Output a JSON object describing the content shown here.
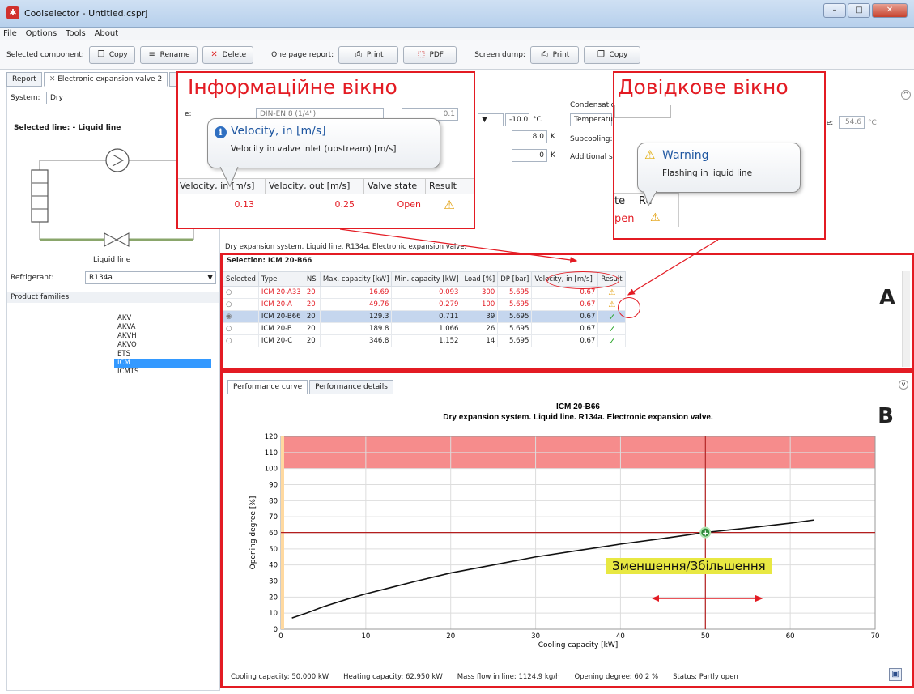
{
  "window": {
    "title": "Coolselector - Untitled.csprj",
    "minimize": "–",
    "maximize": "□",
    "close": "✕"
  },
  "menu": [
    "File",
    "Options",
    "Tools",
    "About"
  ],
  "toolbar": {
    "selected_component_label": "Selected component:",
    "copy": "Copy",
    "rename": "Rename",
    "delete": "Delete",
    "one_page_report_label": "One page report:",
    "print": "Print",
    "pdf": "PDF",
    "screen_dump_label": "Screen dump:",
    "print2": "Print",
    "copy2": "Copy"
  },
  "tabs": {
    "report": "Report",
    "component": "Electronic expansion valve 2",
    "add": "+"
  },
  "left": {
    "system_label": "System:",
    "system_value": "Dry",
    "selected_line": "Selected line: - Liquid line",
    "diagram_caption": "Liquid line",
    "refrigerant_label": "Refrigerant:",
    "refrigerant_value": "R134a",
    "product_families_label": "Product families",
    "families": [
      "AKV",
      "AKVA",
      "AKVH",
      "AKVO",
      "ETS",
      "ICM",
      "ICMTS"
    ],
    "selected_family": "ICM"
  },
  "params": {
    "connection_value": "DIN-EN 8 (1/4\")",
    "connection_extra": "0.1",
    "connection_label_tail": "e:",
    "evap_temp": "-10.0",
    "evap_temp_unit": "°C",
    "superheat": "8.0",
    "superheat_unit": "K",
    "extra": "0",
    "extra_unit": "K",
    "condensation_label": "Condensation",
    "temperature_mode": "Temperature",
    "subcooling_label": "Subcooling:",
    "additional_label": "Additional su",
    "ture_label": "ture:",
    "ture_value": "54.6",
    "ture_unit": "°C"
  },
  "info_panel": {
    "heading": "Інформаційне вікно",
    "tooltip_title": "Velocity, in [m/s]",
    "tooltip_text": "Velocity in valve inlet (upstream) [m/s]",
    "cols": [
      "Velocity, in [m/s]",
      "Velocity, out [m/s]",
      "Valve state",
      "Result"
    ],
    "row": [
      "0.13",
      "0.25",
      "Open"
    ]
  },
  "help_panel": {
    "heading": "Довідкове вікно",
    "tooltip_title": "Warning",
    "tooltip_text": "Flashing in liquid line",
    "col_fragment": "te",
    "col_fragment2": "Re",
    "cell_fragment": "pen"
  },
  "description": "Dry expansion system. Liquid line. R134a. Electronic expansion valve.",
  "selection": {
    "title": "Selection: ICM 20-B66",
    "columns": [
      "Selected",
      "Type",
      "NS",
      "Max. capacity [kW]",
      "Min. capacity [kW]",
      "Load [%]",
      "DP [bar]",
      "Velocity, in [m/s]",
      "Result"
    ],
    "rows": [
      {
        "type": "ICM 20-A33",
        "ns": "20",
        "max": "16.69",
        "min": "0.093",
        "load": "300",
        "dp": "5.695",
        "vel": "0.67",
        "result": "warn",
        "red": true,
        "selected": false
      },
      {
        "type": "ICM 20-A",
        "ns": "20",
        "max": "49.76",
        "min": "0.279",
        "load": "100",
        "dp": "5.695",
        "vel": "0.67",
        "result": "warn",
        "red": true,
        "selected": false
      },
      {
        "type": "ICM 20-B66",
        "ns": "20",
        "max": "129.3",
        "min": "0.711",
        "load": "39",
        "dp": "5.695",
        "vel": "0.67",
        "result": "ok",
        "red": false,
        "selected": true
      },
      {
        "type": "ICM 20-B",
        "ns": "20",
        "max": "189.8",
        "min": "1.066",
        "load": "26",
        "dp": "5.695",
        "vel": "0.67",
        "result": "ok",
        "red": false,
        "selected": false
      },
      {
        "type": "ICM 20-C",
        "ns": "20",
        "max": "346.8",
        "min": "1.152",
        "load": "14",
        "dp": "5.695",
        "vel": "0.67",
        "result": "ok",
        "red": false,
        "selected": false
      }
    ]
  },
  "label_a": "A",
  "label_b": "B",
  "perf_tabs": {
    "curve": "Performance curve",
    "details": "Performance details"
  },
  "chart_data": {
    "type": "line",
    "title": "ICM 20-B66",
    "subtitle": "Dry expansion system. Liquid line. R134a. Electronic expansion valve.",
    "xlabel": "Cooling capacity [kW]",
    "ylabel": "Opening degree [%]",
    "xlim": [
      0,
      70
    ],
    "ylim": [
      0,
      120
    ],
    "xticks": [
      0,
      10,
      20,
      30,
      40,
      50,
      60,
      70
    ],
    "yticks": [
      0,
      10,
      20,
      30,
      40,
      50,
      60,
      70,
      80,
      90,
      100,
      110,
      120
    ],
    "grid": true,
    "overload_band": [
      100,
      120
    ],
    "operating_point": {
      "x": 50,
      "y": 60.2
    },
    "series": [
      {
        "values": [
          [
            1.3,
            7
          ],
          [
            3,
            10
          ],
          [
            5,
            14
          ],
          [
            8,
            19
          ],
          [
            10,
            22
          ],
          [
            13,
            26
          ],
          [
            16,
            30
          ],
          [
            20,
            35
          ],
          [
            25,
            40
          ],
          [
            30,
            45
          ],
          [
            35,
            49
          ],
          [
            40,
            53
          ],
          [
            45,
            56.5
          ],
          [
            50,
            60.2
          ],
          [
            55,
            63
          ],
          [
            60,
            66
          ],
          [
            62.8,
            68
          ]
        ]
      }
    ]
  },
  "zoom_label": "Зменшення/Збільшення",
  "status": {
    "cooling": "Cooling capacity:  50.000 kW",
    "heating": "Heating capacity:  62.950 kW",
    "mass": "Mass flow in line:  1124.9 kg/h",
    "opening": "Opening degree:  60.2 %",
    "state": "Status:  Partly open"
  },
  "colors": {
    "accent_red": "#e31b23",
    "selection_blue": "#3399ff",
    "band": "#f46f6f",
    "zoom_bg": "#e8e842"
  }
}
